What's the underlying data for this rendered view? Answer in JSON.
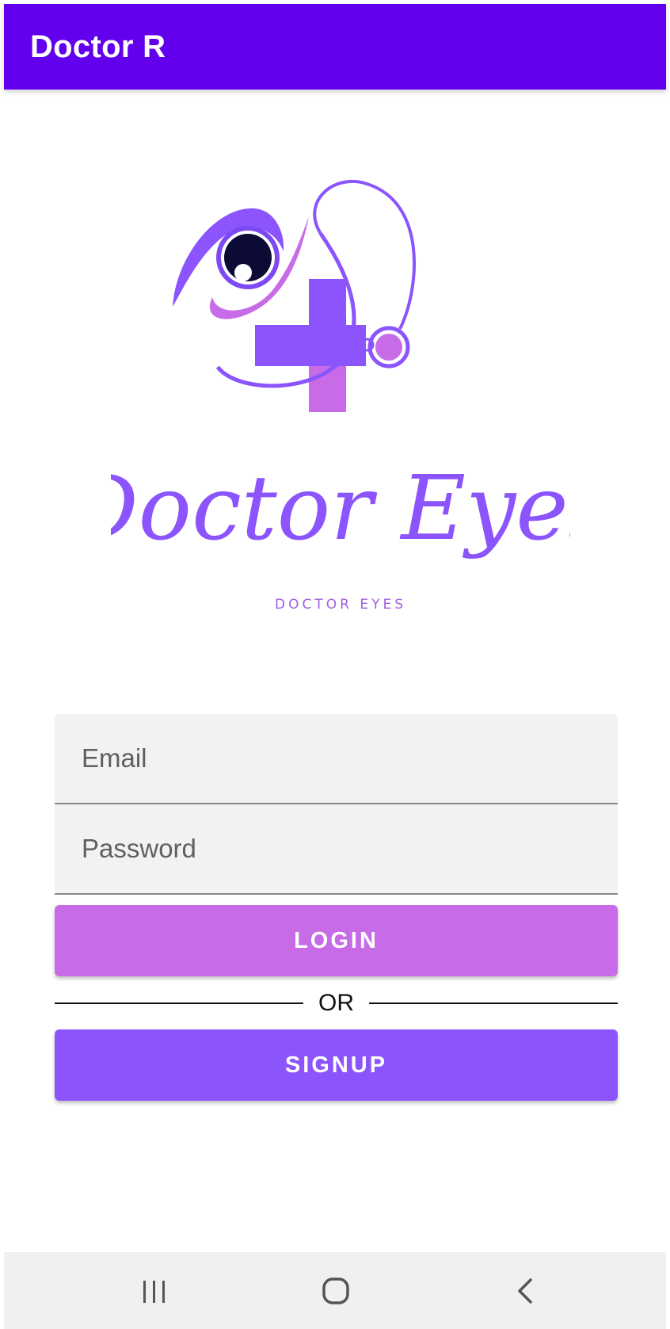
{
  "app_bar": {
    "title": "Doctor R",
    "color": "#6200ee"
  },
  "logo": {
    "script_text": "Doctor Eyes",
    "tagline": "DOCTOR EYES"
  },
  "form": {
    "email_placeholder": "Email",
    "password_placeholder": "Password",
    "login_label": "LOGIN",
    "divider_text": "OR",
    "signup_label": "SIGNUP"
  },
  "colors": {
    "login_button": "#c76ce6",
    "signup_button": "#8b54fd",
    "field_background": "#f2f2f2"
  },
  "nav_bar": {
    "icons": [
      "recents-icon",
      "home-icon",
      "back-icon"
    ]
  }
}
